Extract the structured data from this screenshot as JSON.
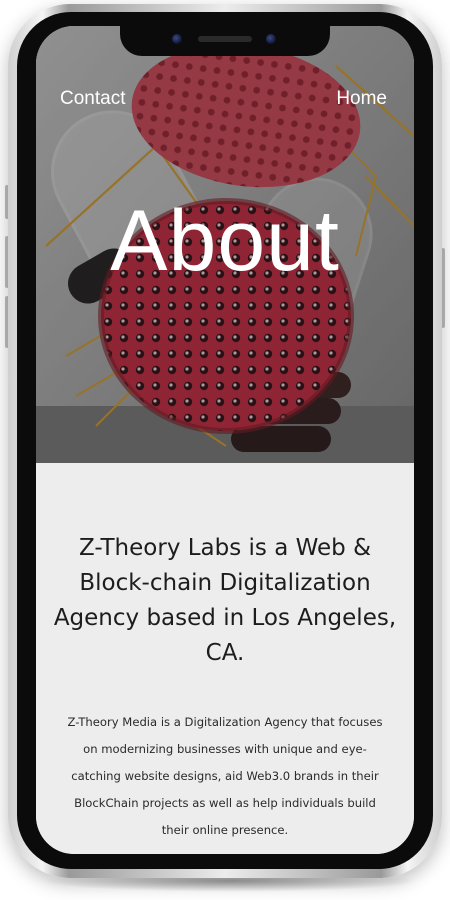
{
  "nav": {
    "contact_label": "Contact",
    "home_label": "Home"
  },
  "hero": {
    "title": "About"
  },
  "content": {
    "headline": "Z-Theory Labs is a Web & Block-chain Digitalization Agency based in Los Angeles, CA.",
    "body": "Z-Theory Media is a Digitalization Agency that focuses on modernizing businesses with unique and eye-catching website designs, aid Web3.0 brands in their BlockChain projects as well as help individuals build their online presence."
  },
  "colors": {
    "hero_accent_red": "#b8243a",
    "hero_accent_gold": "#c2902c",
    "content_background": "#ededed",
    "text_primary": "#1d1d1d"
  }
}
